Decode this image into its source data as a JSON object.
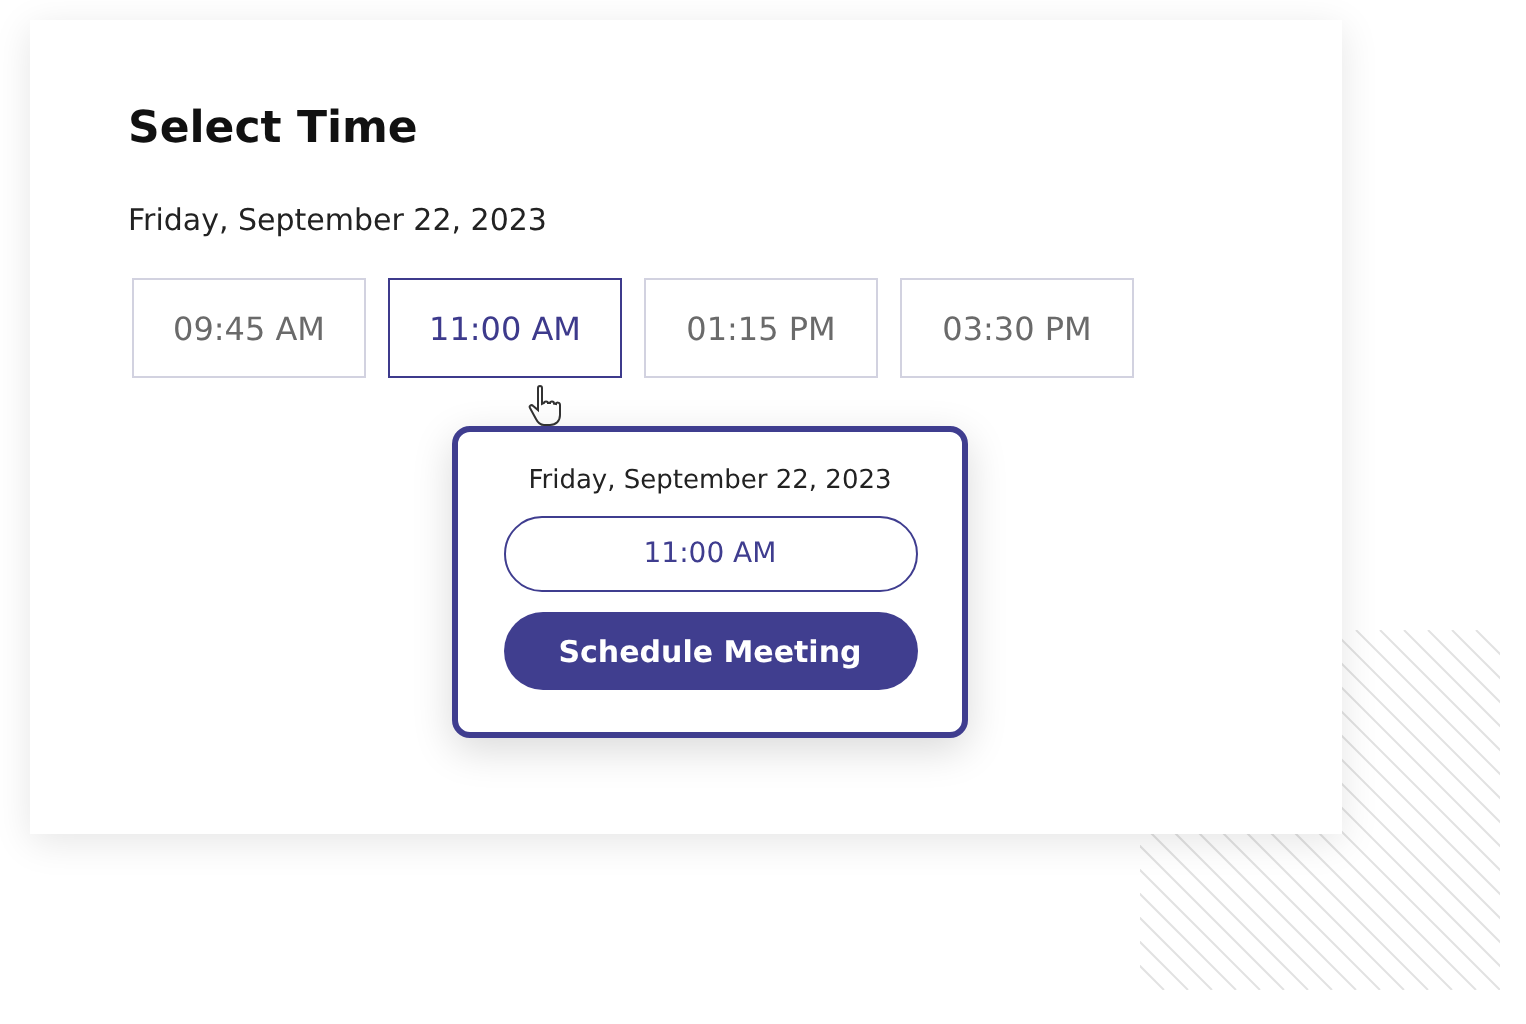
{
  "title": "Select Time",
  "date": "Friday, September 22, 2023",
  "slots": [
    {
      "label": "09:45 AM",
      "selected": false
    },
    {
      "label": "11:00 AM",
      "selected": true
    },
    {
      "label": "01:15 PM",
      "selected": false
    },
    {
      "label": "03:30 PM",
      "selected": false
    }
  ],
  "popover": {
    "date": "Friday, September 22, 2023",
    "time": "11:00 AM",
    "button": "Schedule Meeting"
  }
}
